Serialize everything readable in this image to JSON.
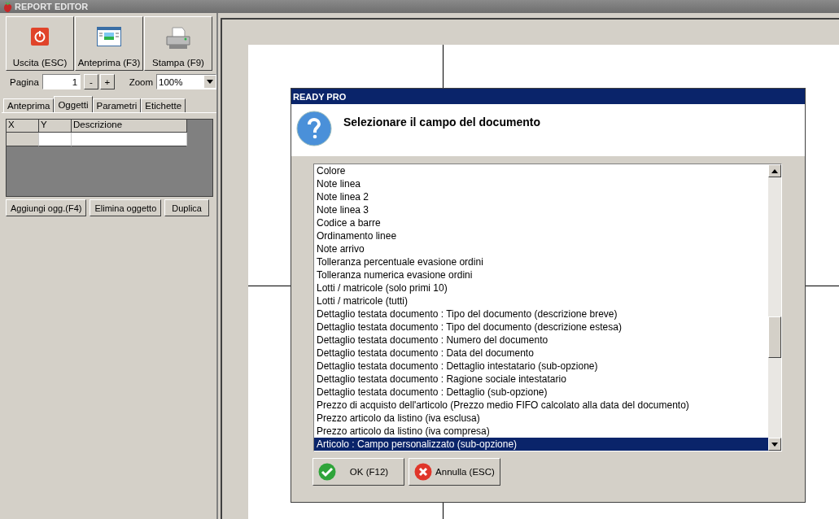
{
  "window": {
    "title": "REPORT EDITOR"
  },
  "toolbar": [
    {
      "kind": "exit",
      "label": "Uscita (ESC)"
    },
    {
      "kind": "preview",
      "label": "Anteprima (F3)"
    },
    {
      "kind": "print",
      "label": "Stampa (F9)"
    }
  ],
  "page_control": {
    "label": "Pagina",
    "value": "1",
    "minus": "-",
    "plus": "+",
    "zoom_label": "Zoom",
    "zoom_value": "100%"
  },
  "tabs": [
    {
      "label": "Anteprima",
      "selected": false
    },
    {
      "label": "Oggetti",
      "selected": true
    },
    {
      "label": "Parametri",
      "selected": false
    },
    {
      "label": "Etichette",
      "selected": false
    }
  ],
  "table": {
    "columns": [
      "X",
      "Y",
      "Descrizione"
    ]
  },
  "object_buttons": [
    "Aggiungi ogg.(F4)",
    "Elimina oggetto",
    "Duplica"
  ],
  "dialog": {
    "title": "READY PRO",
    "message": "Selezionare il campo del documento",
    "items": [
      {
        "label": "Colore",
        "selected": false
      },
      {
        "label": "Note linea",
        "selected": false
      },
      {
        "label": "Note linea 2",
        "selected": false
      },
      {
        "label": "Note linea 3",
        "selected": false
      },
      {
        "label": "Codice a barre",
        "selected": false
      },
      {
        "label": "Ordinamento linee",
        "selected": false
      },
      {
        "label": "Note arrivo",
        "selected": false
      },
      {
        "label": "Tolleranza percentuale evasione ordini",
        "selected": false
      },
      {
        "label": "Tolleranza numerica evasione ordini",
        "selected": false
      },
      {
        "label": "Lotti / matricole (solo primi 10)",
        "selected": false
      },
      {
        "label": "Lotti / matricole (tutti)",
        "selected": false
      },
      {
        "label": "Dettaglio testata documento : Tipo del documento (descrizione breve)",
        "selected": false
      },
      {
        "label": "Dettaglio testata documento : Tipo del documento (descrizione estesa)",
        "selected": false
      },
      {
        "label": "Dettaglio testata documento : Numero del documento",
        "selected": false
      },
      {
        "label": "Dettaglio testata documento : Data del documento",
        "selected": false
      },
      {
        "label": "Dettaglio testata documento : Dettaglio intestatario (sub-opzione)",
        "selected": false
      },
      {
        "label": "Dettaglio testata documento : Ragione sociale intestatario",
        "selected": false
      },
      {
        "label": "Dettaglio testata documento : Dettaglio (sub-opzione)",
        "selected": false
      },
      {
        "label": "Prezzo di acquisto dell'articolo (Prezzo medio FIFO calcolato alla data del documento)",
        "selected": false
      },
      {
        "label": "Prezzo articolo da listino (iva esclusa)",
        "selected": false
      },
      {
        "label": "Prezzo articolo da listino (iva compresa)",
        "selected": false
      },
      {
        "label": "Articolo : Campo personalizzato (sub-opzione)",
        "selected": true
      }
    ],
    "buttons": [
      {
        "kind": "ok",
        "label": "OK (F12)"
      },
      {
        "kind": "cancel",
        "label": "Annulla (ESC)"
      }
    ]
  }
}
